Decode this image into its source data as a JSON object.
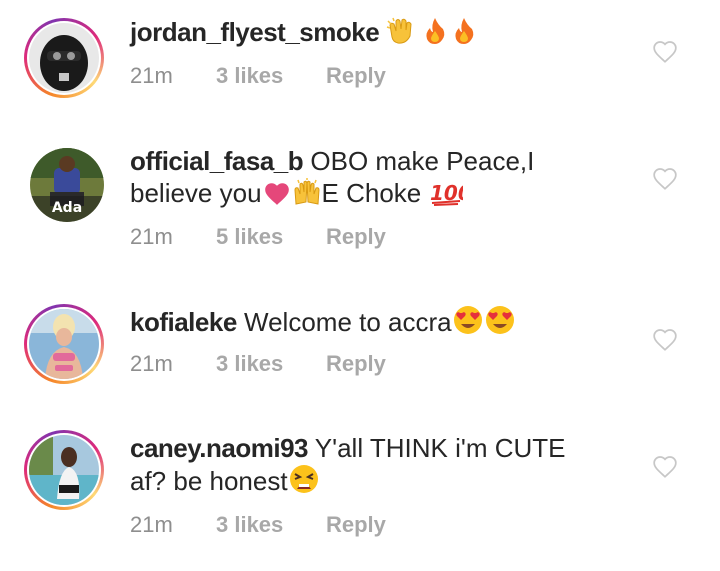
{
  "comments": [
    {
      "username": "jordan_flyest_smoke",
      "text": "",
      "text_line2": "",
      "emojis": [
        "clapping-hands",
        "fire",
        "fire"
      ],
      "time": "21m",
      "likes": "3 likes",
      "reply": "Reply",
      "has_story_ring": true
    },
    {
      "username": "official_fasa_b",
      "text": "OBO make Peace,I",
      "text_line2_prefix": "believe you",
      "text_line2_suffix": "E Choke",
      "avatar_caption": "Ada",
      "emojis": [
        "heart",
        "raising-hands",
        "hundred-points"
      ],
      "time": "21m",
      "likes": "5 likes",
      "reply": "Reply",
      "has_story_ring": false
    },
    {
      "username": "kofialeke",
      "text": "Welcome to accra",
      "emojis": [
        "heart-eyes",
        "heart-eyes"
      ],
      "time": "21m",
      "likes": "3 likes",
      "reply": "Reply",
      "has_story_ring": true
    },
    {
      "username": "caney.naomi93",
      "text": "Y'all THINK i'm CUTE",
      "text_line2": "af? be honest",
      "emojis": [
        "tired-face"
      ],
      "time": "21m",
      "likes": "3 likes",
      "reply": "Reply",
      "has_story_ring": true
    }
  ],
  "colors": {
    "text": "#262626",
    "meta": "#8e8e8e",
    "heart_outline": "#c7c7c7",
    "ring_gradient": [
      "#f58529",
      "#dd2a7b",
      "#8134af"
    ]
  }
}
